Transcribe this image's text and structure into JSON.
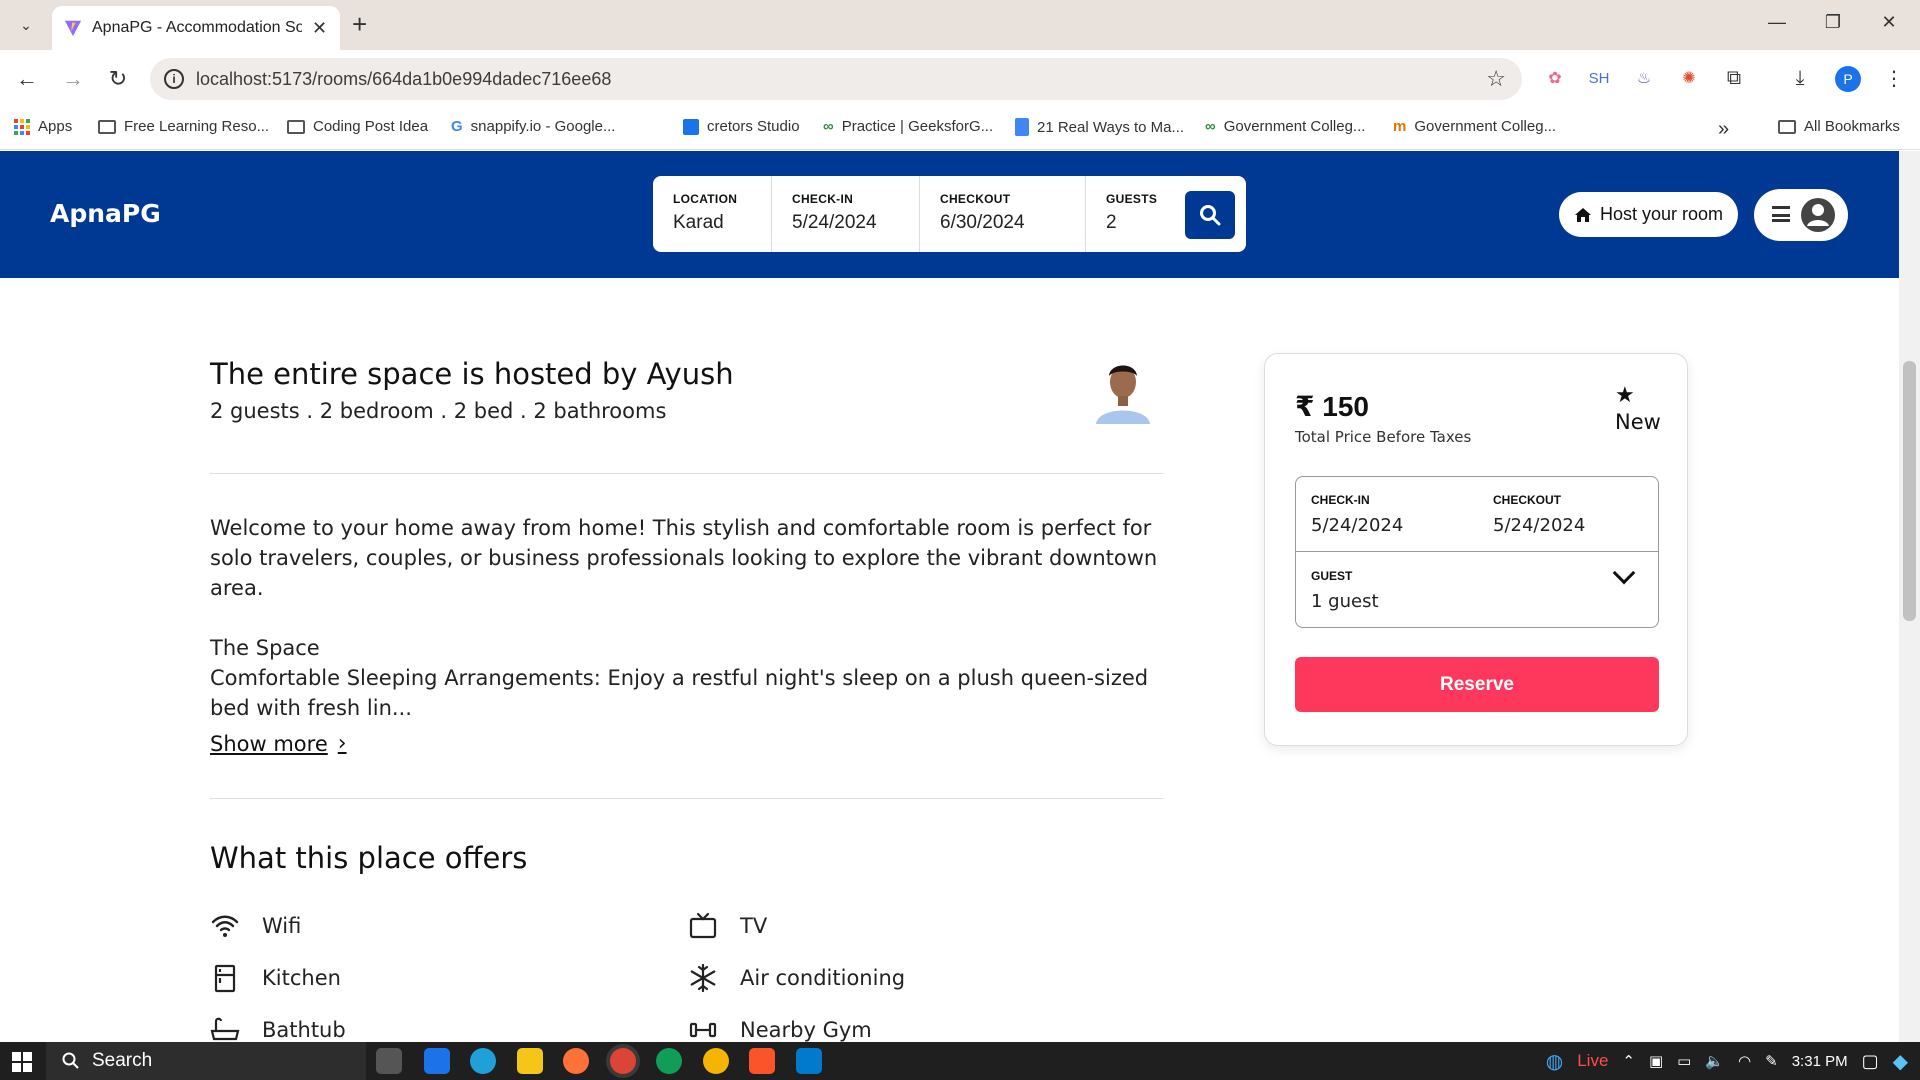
{
  "browser": {
    "tab_title": "ApnaPG - Accommodation Solu",
    "url": "localhost:5173/rooms/664da1b0e994dadec716ee68",
    "profile_initial": "P",
    "ext_sh": "SH",
    "bookmarks": [
      {
        "label": "Apps",
        "icon": "apps-grid-icon"
      },
      {
        "label": "Free Learning Reso...",
        "icon": "folder-icon"
      },
      {
        "label": "Coding Post Idea",
        "icon": "folder-icon"
      },
      {
        "label": "snappify.io - Google...",
        "icon": "google-icon"
      },
      {
        "label": "cretors Studio",
        "icon": "calendar-icon"
      },
      {
        "label": "Practice | GeeksforG...",
        "icon": "geeksforgeeks-icon"
      },
      {
        "label": "21 Real Ways to Ma...",
        "icon": "docs-icon"
      },
      {
        "label": "Government Colleg...",
        "icon": "geeksforgeeks-icon"
      },
      {
        "label": "Government Colleg...",
        "icon": "college-icon"
      }
    ],
    "all_bookmarks": "All Bookmarks"
  },
  "header": {
    "brand": "ApnaPG",
    "search": {
      "location_label": "LOCATION",
      "location_value": "Karad",
      "checkin_label": "CHECK-IN",
      "checkin_value": "5/24/2024",
      "checkout_label": "CHECKOUT",
      "checkout_value": "6/30/2024",
      "guests_label": "GUESTS",
      "guests_value": "2"
    },
    "host_button": "Host your room"
  },
  "listing": {
    "title": "The entire space is hosted by Ayush",
    "details": "2 guests . 2 bedroom . 2 bed . 2 bathrooms",
    "description_1": "Welcome to your home away from home! This stylish and comfortable room is perfect for solo travelers, couples, or business professionals looking to explore the vibrant downtown area.",
    "description_2": "The Space",
    "description_3": "Comfortable Sleeping Arrangements: Enjoy a restful night's sleep on a plush queen-sized bed with fresh lin...",
    "show_more": "Show more",
    "offers_title": "What this place offers",
    "amenities": [
      {
        "label": "Wifi",
        "icon": "wifi-icon"
      },
      {
        "label": "TV",
        "icon": "tv-icon"
      },
      {
        "label": "Kitchen",
        "icon": "kitchen-icon"
      },
      {
        "label": "Air conditioning",
        "icon": "snowflake-icon"
      },
      {
        "label": "Bathtub",
        "icon": "bathtub-icon"
      },
      {
        "label": "Nearby Gym",
        "icon": "dumbbell-icon"
      }
    ]
  },
  "booking": {
    "price": "₹ 150",
    "price_note": "Total Price Before Taxes",
    "rating": "New",
    "checkin_label": "CHECK-IN",
    "checkin_value": "5/24/2024",
    "checkout_label": "CHECKOUT",
    "checkout_value": "5/24/2024",
    "guest_label": "GUEST",
    "guest_value": "1 guest",
    "reserve": "Reserve"
  },
  "taskbar": {
    "search": "Search",
    "live": "Live",
    "time": "3:31 PM"
  },
  "colors": {
    "brand_blue": "#003994",
    "reserve_red": "#fe385c"
  }
}
